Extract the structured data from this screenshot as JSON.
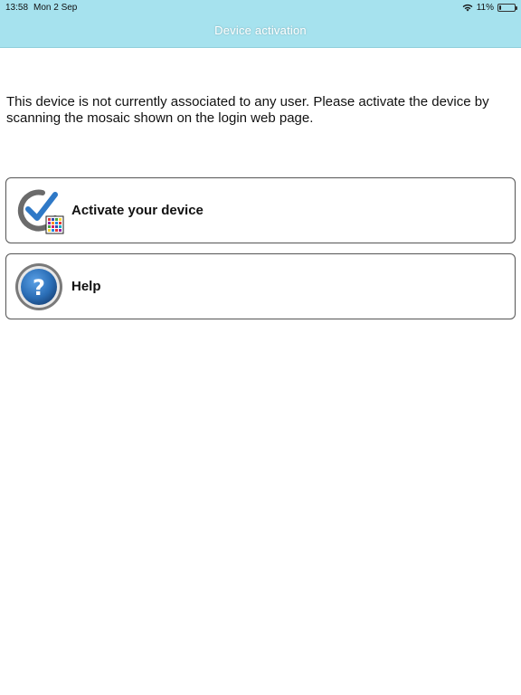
{
  "status_bar": {
    "time": "13:58",
    "date": "Mon 2 Sep",
    "battery_percent_text": "11%",
    "battery_level": 0.11,
    "icons": [
      "wifi-icon",
      "battery-icon"
    ]
  },
  "nav": {
    "title": "Device activation"
  },
  "content": {
    "message": "This device is not currently associated to any user. Please activate the device by scanning the mosaic shown on the login web page."
  },
  "menu": {
    "items": [
      {
        "label": "Activate your device",
        "icon": "activate-mosaic-icon"
      },
      {
        "label": "Help",
        "icon": "help-icon"
      }
    ]
  },
  "colors": {
    "header_bg": "#a6e2ee",
    "help_blue": "#2a6db5",
    "check_blue": "#2f79c7"
  }
}
